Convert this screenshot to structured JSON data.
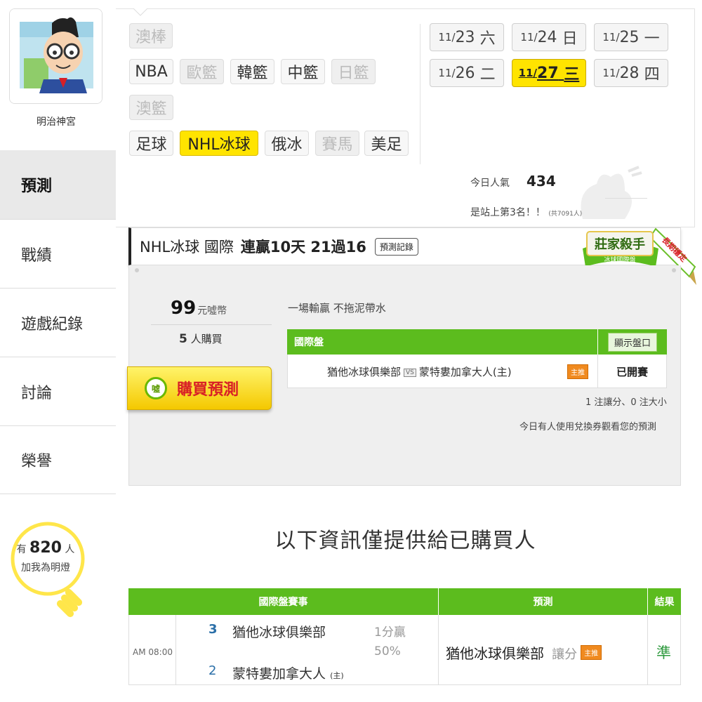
{
  "profile": {
    "name": "明治神宮"
  },
  "sidebar": {
    "items": [
      {
        "label": "預測"
      },
      {
        "label": "戰績"
      },
      {
        "label": "遊戲紀錄"
      },
      {
        "label": "討論"
      },
      {
        "label": "榮譽"
      }
    ],
    "fans_prefix": "有",
    "fans_count": "820",
    "fans_suffix": "人",
    "fans_caption": "加我為明燈"
  },
  "sports": {
    "row1": [
      "澳棒"
    ],
    "row2": [
      "NBA",
      "歐籃",
      "韓籃",
      "中籃",
      "日籃"
    ],
    "row3": [
      "澳籃"
    ],
    "row4": [
      "足球",
      "NHL冰球",
      "俄冰",
      "賽馬",
      "美足"
    ],
    "active": "NHL冰球"
  },
  "dates": [
    {
      "md": "11/",
      "day": "23",
      "wd": "六"
    },
    {
      "md": "11/",
      "day": "24",
      "wd": "日"
    },
    {
      "md": "11/",
      "day": "25",
      "wd": "一"
    },
    {
      "md": "11/",
      "day": "26",
      "wd": "二"
    },
    {
      "md": "11/",
      "day": "27",
      "wd": "三"
    },
    {
      "md": "11/",
      "day": "28",
      "wd": "四"
    }
  ],
  "popularity": {
    "label": "今日人氣",
    "value": "434",
    "rank_text": "是站上第3名！！",
    "rank_total": "(共7091人)"
  },
  "record": {
    "league": "NHL冰球 國際",
    "streak": "連贏10天 21過16",
    "history_button": "預測記錄",
    "badge_main": "莊家殺手",
    "badge_sub": "冰球國際盤",
    "badge_ribbon": "長期穩定"
  },
  "purchase": {
    "price": "99",
    "price_unit": "元噓幣",
    "buyers_count": "5",
    "buyers_label": "人購買",
    "buy_button": "購買預測",
    "buy_icon": "噓",
    "slogan": "一場輸贏 不拖泥帶水"
  },
  "intl_panel": {
    "title": "國際盤",
    "show_button": "顯示盤口",
    "away_team": "猶他冰球俱樂部",
    "vs": "VS",
    "home_team": "蒙特婁加拿大人(主)",
    "tag": "主推",
    "status": "已開賽",
    "bet_summary": "1 注讓分、0 注大小",
    "voucher_note": "今日有人使用兌換券觀看您的預測"
  },
  "buyers_only_notice": "以下資訊僅提供給已購買人",
  "results_table": {
    "headers": [
      "國際盤賽事",
      "預測",
      "結果"
    ],
    "row": {
      "time": "AM 08:00",
      "away_score": "3",
      "away_team": "猶他冰球俱樂部",
      "home_score": "2",
      "home_team": "蒙特婁加拿大人",
      "home_mark": "(主)",
      "line": "1分贏",
      "line_pct": "50%",
      "pick_team": "猶他冰球俱樂部",
      "pick_type": "讓分",
      "pick_tag": "主推",
      "result": "準"
    }
  },
  "colors": {
    "accent_green": "#5cbc1e",
    "highlight_yellow": "#ffe400",
    "buy_red": "#d81f26"
  }
}
